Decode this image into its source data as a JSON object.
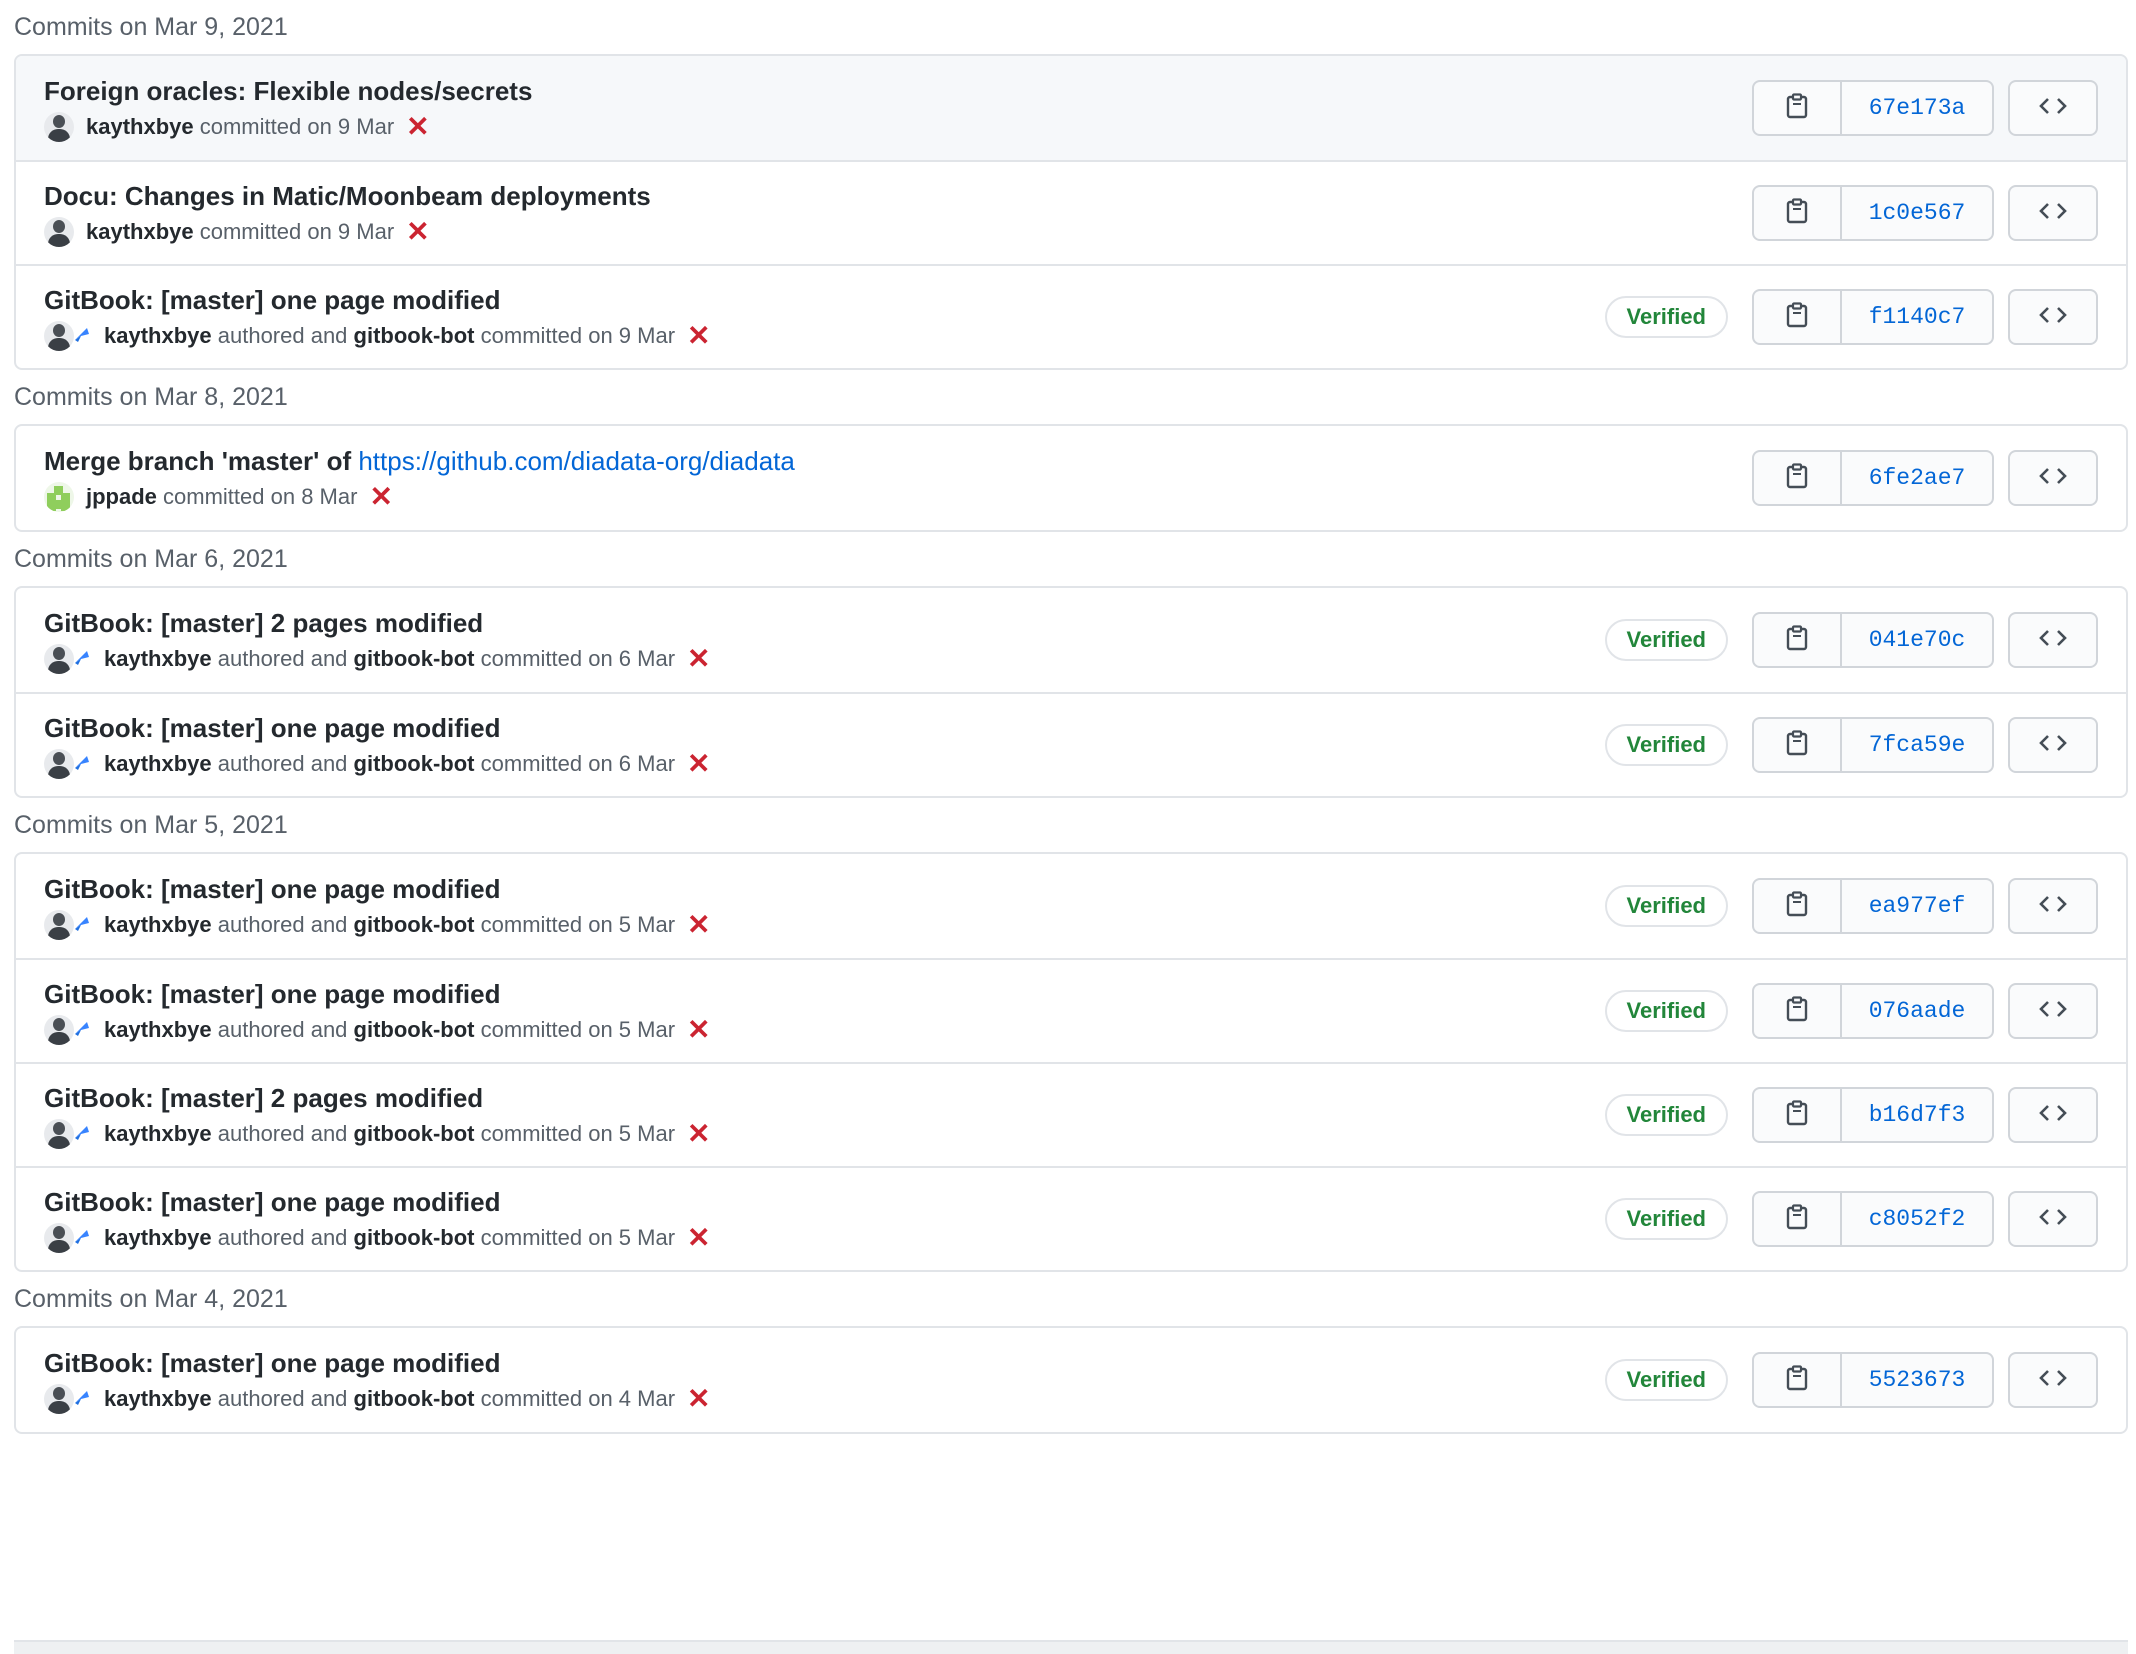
{
  "groups": [
    {
      "heading": "Commits on Mar 9, 2021",
      "commits": [
        {
          "title": "Foreign oracles: Flexible nodes/secrets",
          "author": "kaythxbye",
          "text": "committed on 9 Mar",
          "sha": "67e173a",
          "verified": false,
          "highlight": true
        },
        {
          "title": "Docu: Changes in Matic/Moonbeam deployments",
          "author": "kaythxbye",
          "text": "committed on 9 Mar",
          "sha": "1c0e567",
          "verified": false
        },
        {
          "title": "GitBook: [master] one page modified",
          "author": "kaythxbye",
          "coauthor": "gitbook-bot",
          "authored_text": "authored and",
          "text": "committed on 9 Mar",
          "sha": "f1140c7",
          "verified": true
        }
      ]
    },
    {
      "heading": "Commits on Mar 8, 2021",
      "commits": [
        {
          "title": "Merge branch 'master' of ",
          "link": "https://github.com/diadata-org/diadata",
          "author": "jppade",
          "text": "committed on 8 Mar",
          "sha": "6fe2ae7",
          "verified": false,
          "avatar": "jp"
        }
      ]
    },
    {
      "heading": "Commits on Mar 6, 2021",
      "commits": [
        {
          "title": "GitBook: [master] 2 pages modified",
          "author": "kaythxbye",
          "coauthor": "gitbook-bot",
          "authored_text": "authored and",
          "text": "committed on 6 Mar",
          "sha": "041e70c",
          "verified": true
        },
        {
          "title": "GitBook: [master] one page modified",
          "author": "kaythxbye",
          "coauthor": "gitbook-bot",
          "authored_text": "authored and",
          "text": "committed on 6 Mar",
          "sha": "7fca59e",
          "verified": true
        }
      ]
    },
    {
      "heading": "Commits on Mar 5, 2021",
      "commits": [
        {
          "title": "GitBook: [master] one page modified",
          "author": "kaythxbye",
          "coauthor": "gitbook-bot",
          "authored_text": "authored and",
          "text": "committed on 5 Mar",
          "sha": "ea977ef",
          "verified": true
        },
        {
          "title": "GitBook: [master] one page modified",
          "author": "kaythxbye",
          "coauthor": "gitbook-bot",
          "authored_text": "authored and",
          "text": "committed on 5 Mar",
          "sha": "076aade",
          "verified": true
        },
        {
          "title": "GitBook: [master] 2 pages modified",
          "author": "kaythxbye",
          "coauthor": "gitbook-bot",
          "authored_text": "authored and",
          "text": "committed on 5 Mar",
          "sha": "b16d7f3",
          "verified": true
        },
        {
          "title": "GitBook: [master] one page modified",
          "author": "kaythxbye",
          "coauthor": "gitbook-bot",
          "authored_text": "authored and",
          "text": "committed on 5 Mar",
          "sha": "c8052f2",
          "verified": true
        }
      ]
    },
    {
      "heading": "Commits on Mar 4, 2021",
      "commits": [
        {
          "title": "GitBook: [master] one page modified",
          "author": "kaythxbye",
          "coauthor": "gitbook-bot",
          "authored_text": "authored and",
          "text": "committed on 4 Mar",
          "sha": "5523673",
          "verified": true
        }
      ]
    }
  ],
  "labels": {
    "verified": "Verified",
    "status_icon": "x-icon",
    "copy_icon": "clipboard-icon",
    "browse_icon": "code-icon"
  },
  "colors": {
    "link": "#0366d6",
    "verified": "#22863a",
    "fail": "#cb2431",
    "border": "#e1e4e8"
  }
}
